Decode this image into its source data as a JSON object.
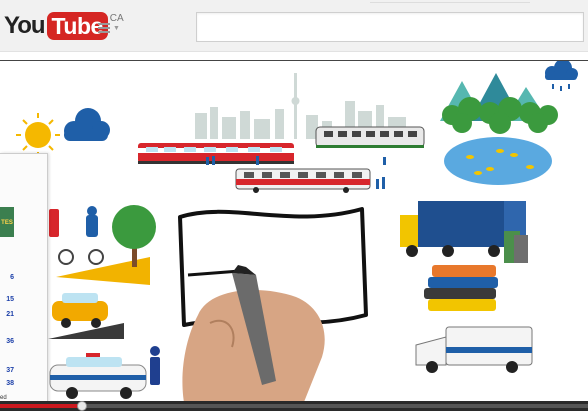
{
  "masthead": {
    "logo_you": "You",
    "logo_tube": "Tube",
    "region": "CA",
    "guide_icon": "guide-menu-icon",
    "search_placeholder": ""
  },
  "player": {
    "progress_fraction": 0.14,
    "colors": {
      "played": "#cc181e",
      "brand": "#d52623"
    }
  },
  "overlay": {
    "logo_text": "TES",
    "numbers": [
      "6",
      "15",
      "21",
      "36",
      "37",
      "38"
    ],
    "label": "ed"
  }
}
